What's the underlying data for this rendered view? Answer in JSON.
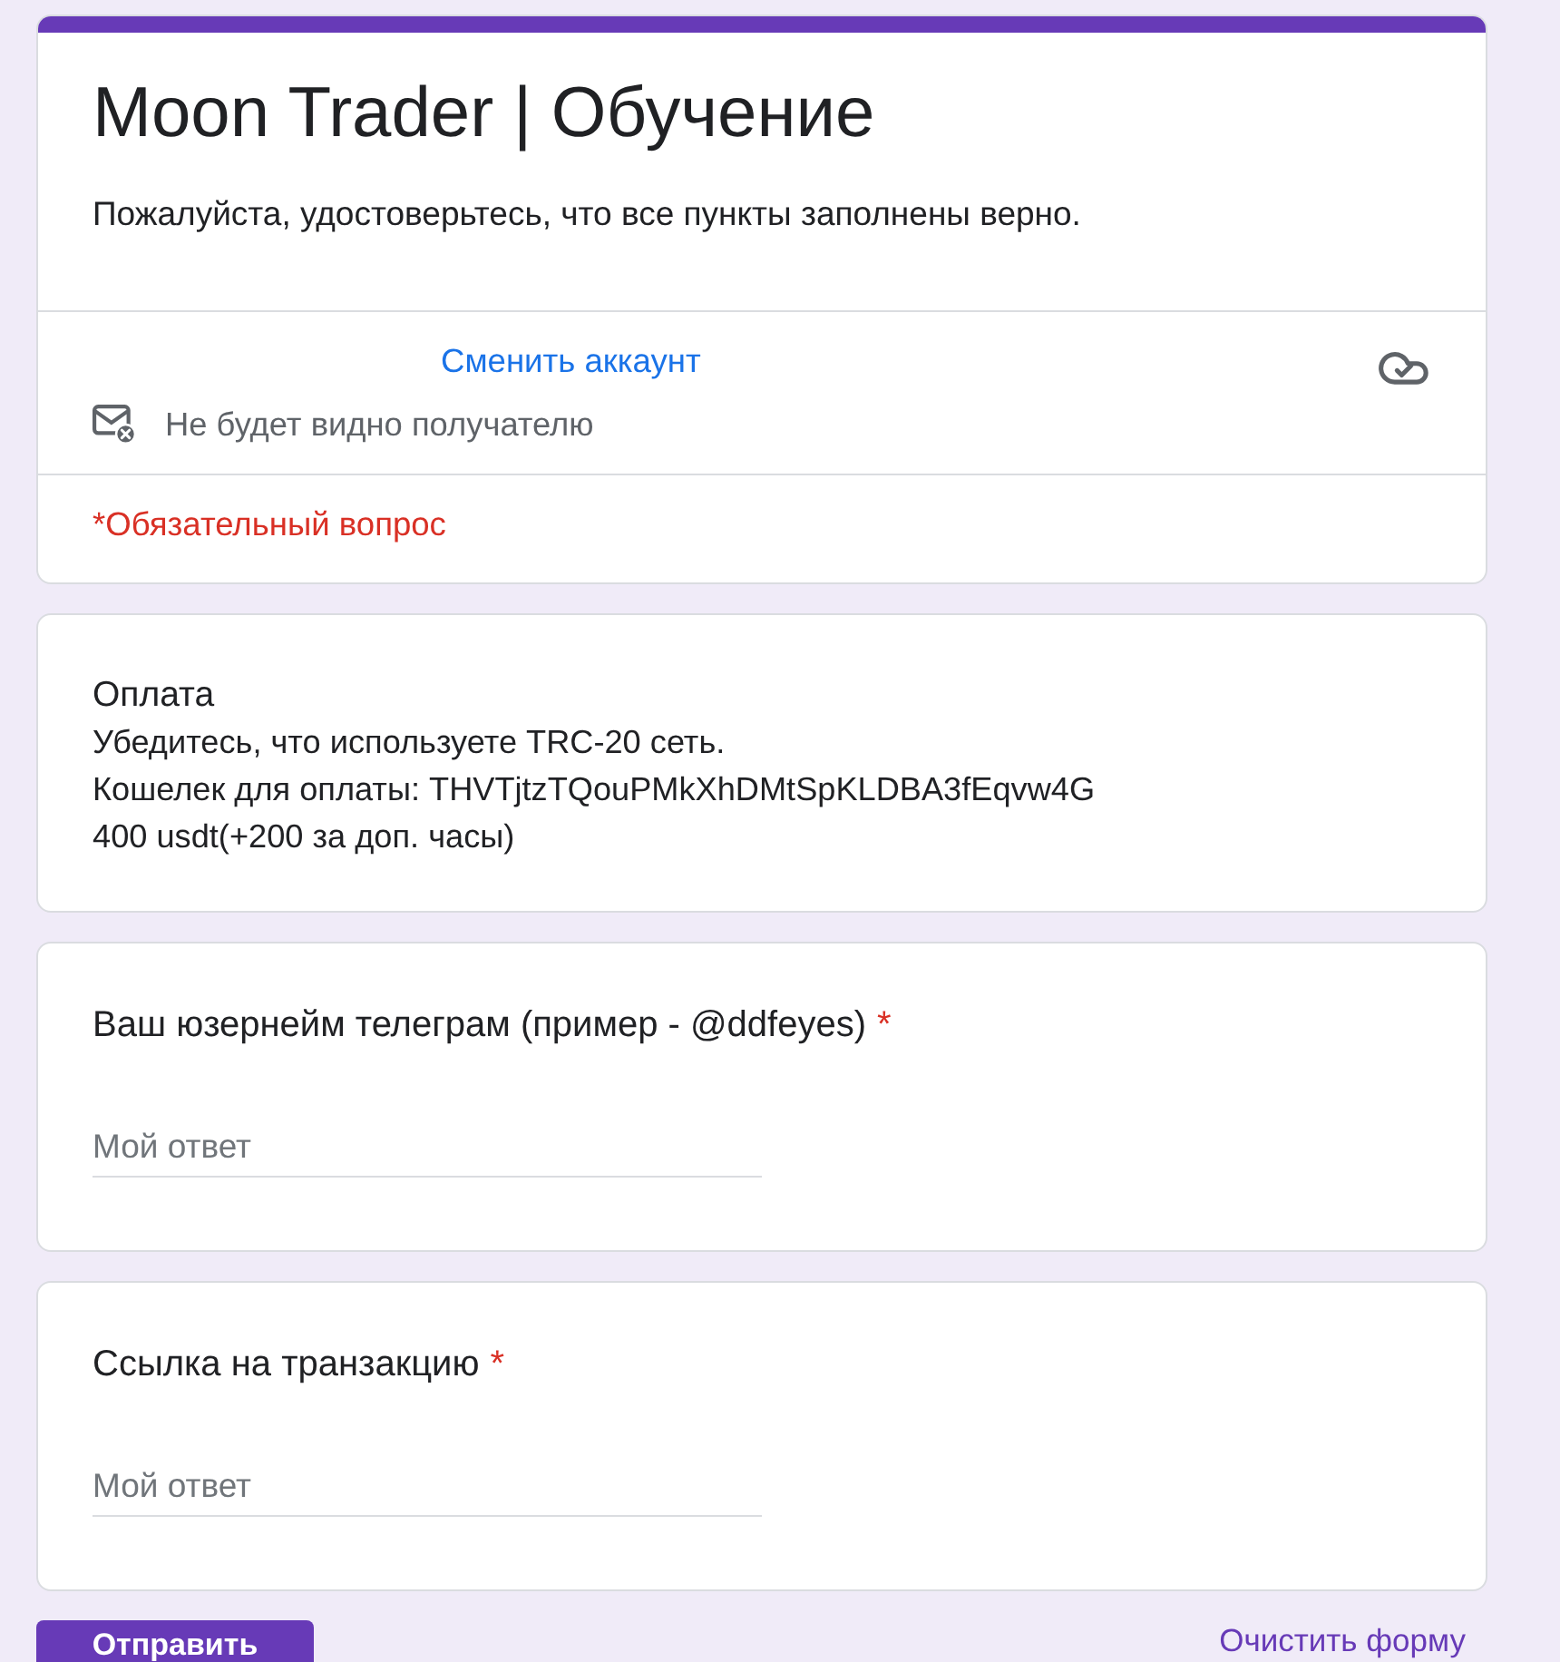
{
  "form": {
    "title": "Moon Trader | Обучение",
    "description": "Пожалуйста, удостоверьтесь, что все пункты заполнены верно.",
    "account": {
      "switch_link": "Сменить аккаунт",
      "privacy_note": "Не будет видно получателю"
    },
    "required_note": "*Обязательный вопрос"
  },
  "info_section": {
    "title": "Оплата",
    "lines": [
      "Убедитесь, что используете TRC-20 сеть.",
      "Кошелек для оплаты: THVTjtzTQouPMkXhDMtSpKLDBA3fEqvw4G",
      "400 usdt(+200 за доп. часы)"
    ]
  },
  "questions": [
    {
      "label": "Ваш юзернейм телеграм (пример - @ddfeyes)",
      "required_mark": "*",
      "placeholder": "Мой ответ"
    },
    {
      "label": "Ссылка на транзакцию",
      "required_mark": "*",
      "placeholder": "Мой ответ"
    }
  ],
  "actions": {
    "submit": "Отправить",
    "clear": "Очистить форму"
  }
}
